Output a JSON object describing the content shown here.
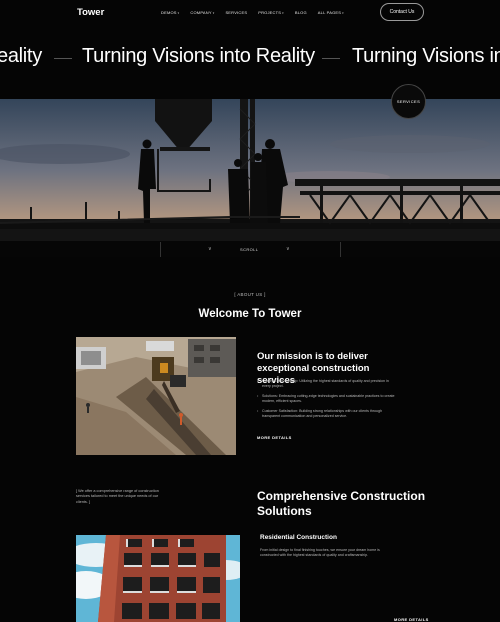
{
  "nav": {
    "logo": "Tower",
    "items": [
      {
        "label": "DEMOS",
        "has_dropdown": true
      },
      {
        "label": "COMPANY",
        "has_dropdown": true
      },
      {
        "label": "SERVICES",
        "has_dropdown": false
      },
      {
        "label": "PROJECTS",
        "has_dropdown": true
      },
      {
        "label": "BLOG",
        "has_dropdown": false
      },
      {
        "label": "ALL PAGES",
        "has_dropdown": true
      }
    ],
    "contact_label": "Contact Us"
  },
  "marquee": {
    "left_fragment": "eality",
    "middle_text": "Turning Visions into Reality",
    "right_text": "Turning Visions in"
  },
  "hero": {
    "services_badge": "SERVICES",
    "scroll_label": "SCROLL",
    "chevron_glyph": "∨"
  },
  "about": {
    "tag": "[ ABOUT US ]",
    "title": "Welcome To Tower",
    "mission_title": "Our mission is to deliver exceptional construction services",
    "bullets": [
      "Quality Craftsmanship: Utilizing the highest standards of quality and precision in every project.",
      "Solutions: Embracing cutting-edge technologies and sustainable practices to create modern, efficient spaces.",
      "Customer Satisfaction: Building strong relationships with our clients through transparent communication and personalized service."
    ],
    "more_label": "MORE DETAILS"
  },
  "services": {
    "intro": "[ We offer a comprehensive range of construction services tailored to meet the unique needs of our clients. ]",
    "title": "Comprehensive Construction Solutions",
    "first_service_title": "Residential Construction",
    "first_service_desc": "From initial design to final finishing touches, we ensure your dream home is constructed with the highest standards of quality and craftsmanship.",
    "more_label": "MORE DETAILS"
  },
  "colors": {
    "background": "#050505",
    "text": "#ffffff",
    "muted_text": "#b9b9b9",
    "sky_top": "#3a4a5e",
    "sky_horizon": "#c9a27d"
  }
}
